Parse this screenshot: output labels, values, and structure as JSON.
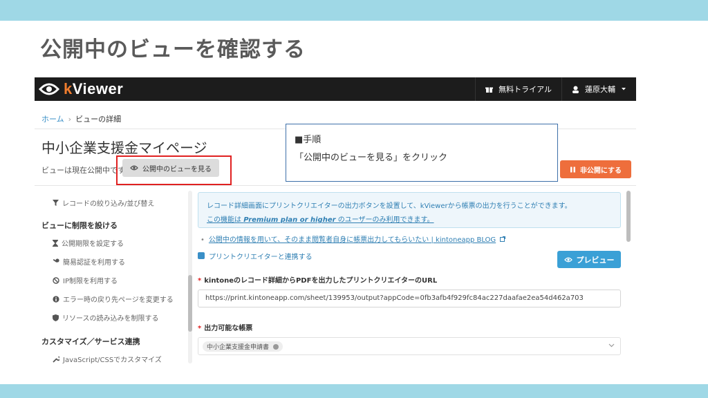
{
  "slide": {
    "title": "公開中のビューを確認する"
  },
  "app": {
    "logo_k": "k",
    "logo_rest": "Viewer",
    "nav": {
      "trial": "無料トライアル",
      "user": "蓮原大輔"
    }
  },
  "breadcrumb": {
    "home": "ホーム",
    "sep": "›",
    "current": "ビューの詳細"
  },
  "page": {
    "title": "中小企業支援金マイページ",
    "status_text": "ビューは現在公開中です",
    "public_view_button": "公開中のビューを見る",
    "make_private_button": "非公開にする"
  },
  "sidebar": {
    "items": [
      {
        "label": "レコードの絞り込み/並び替え",
        "icon": "filter-icon"
      },
      {
        "heading": "ビューに制限を設ける"
      },
      {
        "label": "公開期限を設定する",
        "icon": "hourglass-icon"
      },
      {
        "label": "簡易認証を利用する",
        "icon": "key-icon"
      },
      {
        "label": "IP制限を利用する",
        "icon": "ban-icon"
      },
      {
        "label": "エラー時の戻り先ページを変更する",
        "icon": "info-icon"
      },
      {
        "label": "リソースの読み込みを制限する",
        "icon": "shield-icon"
      },
      {
        "heading": "カスタマイズ／サービス連携"
      },
      {
        "label": "JavaScript/CSSでカスタマイズ",
        "icon": "wrench-icon"
      }
    ]
  },
  "main": {
    "info_line1": "レコード詳細画面にプリントクリエイターの出力ボタンを設置して、kViewerから帳票の出力を行うことができます。",
    "info_line2_pre": "この機能は ",
    "info_line2_plan": "Premium plan or higher",
    "info_line2_post": " のユーザーのみ利用できます。",
    "blog_link": "公開中の情報を用いて、そのまま閲覧者自身に帳票出力してもらいたい | kintoneapp BLOG",
    "checkbox_label": "プリントクリエイターと連携する",
    "preview_button": "プレビュー",
    "url_label": "kintoneのレコード詳細からPDFを出力したプリントクリエイターのURL",
    "url_value": "https://print.kintoneapp.com/sheet/139953/output?appCode=0fb3afb4f929fc84ac227daafae2ea54d462a703",
    "forms_label": "出力可能な帳票",
    "form_tag": "中小企業支援金申請書"
  },
  "callout": {
    "head": "■手順",
    "body": "「公開中のビューを見る」をクリック"
  },
  "colors": {
    "accent_orange": "#ee6e3c",
    "accent_blue": "#3aa0d6",
    "highlight_red": "#e02020",
    "band": "#9fd8e6"
  }
}
